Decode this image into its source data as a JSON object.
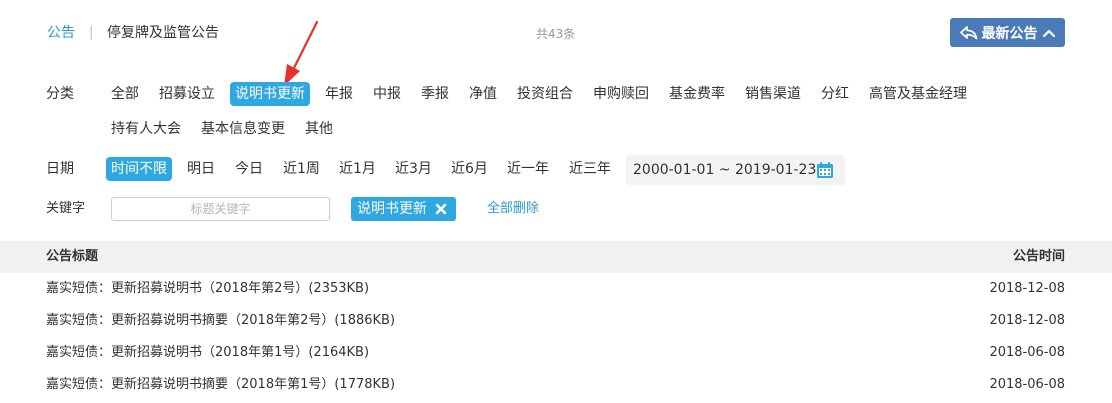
{
  "header": {
    "tab_notice": "公告",
    "separator": "|",
    "tab_suspension": "停复牌及监管公告",
    "total_count": "共43条",
    "latest_button": "最新公告"
  },
  "filters": {
    "category_label": "分类",
    "categories": [
      "全部",
      "招募设立",
      "说明书更新",
      "年报",
      "中报",
      "季报",
      "净值",
      "投资组合",
      "申购赎回",
      "基金费率",
      "销售渠道",
      "分红",
      "高管及基金经理",
      "持有人大会",
      "基本信息变更",
      "其他"
    ],
    "selected_category": "说明书更新",
    "date_label": "日期",
    "date_options": [
      "时间不限",
      "明日",
      "今日",
      "近1周",
      "近1月",
      "近3月",
      "近6月",
      "近一年",
      "近三年"
    ],
    "selected_date": "时间不限",
    "date_range": "2000-01-01 ~ 2019-01-23",
    "keyword_label": "关键字",
    "keyword_placeholder": "标题关键字",
    "keyword_value": "",
    "active_tag": "说明书更新",
    "clear_all": "全部删除"
  },
  "table": {
    "col_title": "公告标题",
    "col_date": "公告时间",
    "rows": [
      {
        "title": "嘉实短债：更新招募说明书（2018年第2号）(2353KB)",
        "date": "2018-12-08"
      },
      {
        "title": "嘉实短债：更新招募说明书摘要（2018年第2号）(1886KB)",
        "date": "2018-12-08"
      },
      {
        "title": "嘉实短债：更新招募说明书（2018年第1号）(2164KB)",
        "date": "2018-06-08"
      },
      {
        "title": "嘉实短债：更新招募说明书摘要（2018年第1号）(1778KB)",
        "date": "2018-06-08"
      }
    ]
  },
  "colors": {
    "accent": "#2fa7e0",
    "button": "#4a7ab8",
    "link": "#2b9bd3",
    "annotation": "#e8312a"
  },
  "icons": {
    "latest_left": "reply-arrow-icon",
    "latest_right": "chevron-up-icon",
    "date": "calendar-icon",
    "tag_remove": "close-icon"
  }
}
